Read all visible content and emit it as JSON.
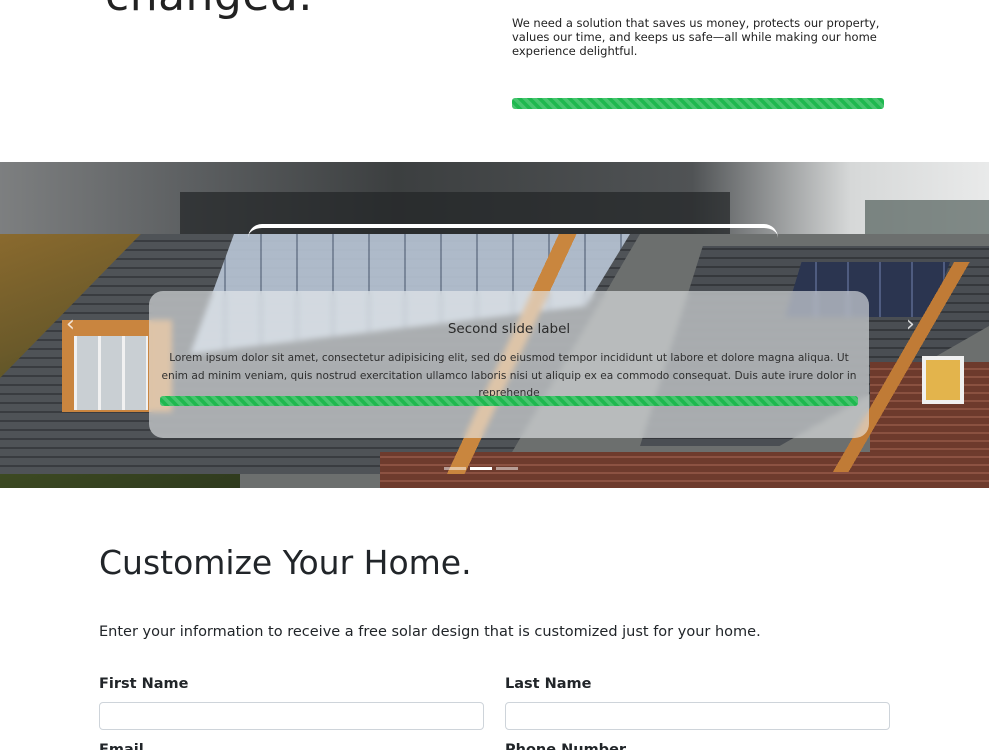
{
  "hero": {
    "title": "changed.",
    "copy": "We need a solution that saves us money, protects our property, values our time, and keeps us safe—all while making our home experience delightful.",
    "progress_percent": 100
  },
  "carousel": {
    "prev_icon": "chevron-left-icon",
    "next_icon": "chevron-right-icon",
    "active_slide": 2,
    "slide_count": 3,
    "caption": {
      "title": "Second slide label",
      "text": "Lorem ipsum dolor sit amet, consectetur adipisicing elit, sed do eiusmod tempor incididunt ut labore et dolore magna aliqua. Ut enim ad minim veniam, quis nostrud exercitation ullamco laboris nisi ut aliquip ex ea commodo consequat. Duis aute irure dolor in reprehende",
      "progress_percent": 100
    }
  },
  "form": {
    "title": "Customize Your Home.",
    "lead": "Enter your information to receive a free solar design that is customized just for your home.",
    "first_name_label": "First Name",
    "first_name_value": "",
    "last_name_label": "Last Name",
    "last_name_value": "",
    "email_label": "Email",
    "phone_label": "Phone Number"
  },
  "colors": {
    "progress": "#1fb84f",
    "text": "#212529"
  }
}
